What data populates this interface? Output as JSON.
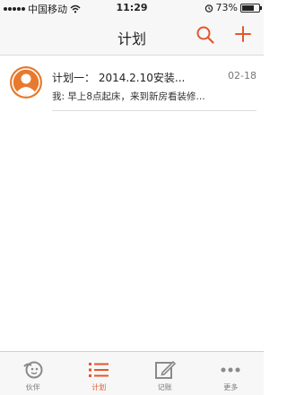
{
  "status_bar": {
    "carrier": "中国移动",
    "time": "11:29",
    "battery_percent": "73%",
    "battery_level": 0.73
  },
  "nav": {
    "title": "计划"
  },
  "plans": [
    {
      "title": "计划一： 2014.2.10安装...",
      "date": "02-18",
      "preview": "我: 早上8点起床，来到新房看装修..."
    }
  ],
  "tabs": [
    {
      "label": "伙伴",
      "icon": "partner-icon",
      "active": false
    },
    {
      "label": "计划",
      "icon": "list-icon",
      "active": true
    },
    {
      "label": "记账",
      "icon": "edit-icon",
      "active": false
    },
    {
      "label": "更多",
      "icon": "more-icon",
      "active": false
    }
  ],
  "colors": {
    "accent": "#e4562b",
    "avatar_bg": "#e77a2e",
    "inactive_icon": "#8a8a8a"
  }
}
